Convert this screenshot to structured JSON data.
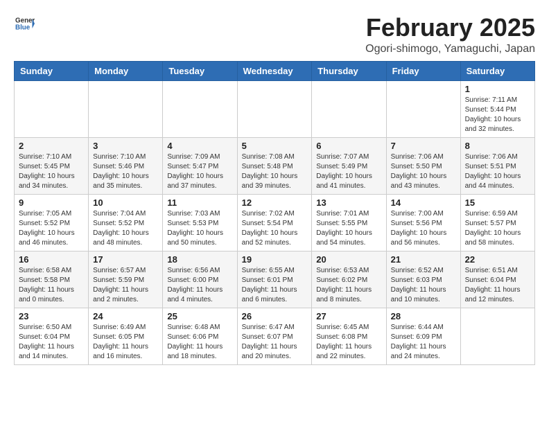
{
  "header": {
    "logo_general": "General",
    "logo_blue": "Blue",
    "month_title": "February 2025",
    "location": "Ogori-shimogo, Yamaguchi, Japan"
  },
  "weekdays": [
    "Sunday",
    "Monday",
    "Tuesday",
    "Wednesday",
    "Thursday",
    "Friday",
    "Saturday"
  ],
  "weeks": [
    [
      {
        "day": "",
        "info": ""
      },
      {
        "day": "",
        "info": ""
      },
      {
        "day": "",
        "info": ""
      },
      {
        "day": "",
        "info": ""
      },
      {
        "day": "",
        "info": ""
      },
      {
        "day": "",
        "info": ""
      },
      {
        "day": "1",
        "info": "Sunrise: 7:11 AM\nSunset: 5:44 PM\nDaylight: 10 hours and 32 minutes."
      }
    ],
    [
      {
        "day": "2",
        "info": "Sunrise: 7:10 AM\nSunset: 5:45 PM\nDaylight: 10 hours and 34 minutes."
      },
      {
        "day": "3",
        "info": "Sunrise: 7:10 AM\nSunset: 5:46 PM\nDaylight: 10 hours and 35 minutes."
      },
      {
        "day": "4",
        "info": "Sunrise: 7:09 AM\nSunset: 5:47 PM\nDaylight: 10 hours and 37 minutes."
      },
      {
        "day": "5",
        "info": "Sunrise: 7:08 AM\nSunset: 5:48 PM\nDaylight: 10 hours and 39 minutes."
      },
      {
        "day": "6",
        "info": "Sunrise: 7:07 AM\nSunset: 5:49 PM\nDaylight: 10 hours and 41 minutes."
      },
      {
        "day": "7",
        "info": "Sunrise: 7:06 AM\nSunset: 5:50 PM\nDaylight: 10 hours and 43 minutes."
      },
      {
        "day": "8",
        "info": "Sunrise: 7:06 AM\nSunset: 5:51 PM\nDaylight: 10 hours and 44 minutes."
      }
    ],
    [
      {
        "day": "9",
        "info": "Sunrise: 7:05 AM\nSunset: 5:52 PM\nDaylight: 10 hours and 46 minutes."
      },
      {
        "day": "10",
        "info": "Sunrise: 7:04 AM\nSunset: 5:52 PM\nDaylight: 10 hours and 48 minutes."
      },
      {
        "day": "11",
        "info": "Sunrise: 7:03 AM\nSunset: 5:53 PM\nDaylight: 10 hours and 50 minutes."
      },
      {
        "day": "12",
        "info": "Sunrise: 7:02 AM\nSunset: 5:54 PM\nDaylight: 10 hours and 52 minutes."
      },
      {
        "day": "13",
        "info": "Sunrise: 7:01 AM\nSunset: 5:55 PM\nDaylight: 10 hours and 54 minutes."
      },
      {
        "day": "14",
        "info": "Sunrise: 7:00 AM\nSunset: 5:56 PM\nDaylight: 10 hours and 56 minutes."
      },
      {
        "day": "15",
        "info": "Sunrise: 6:59 AM\nSunset: 5:57 PM\nDaylight: 10 hours and 58 minutes."
      }
    ],
    [
      {
        "day": "16",
        "info": "Sunrise: 6:58 AM\nSunset: 5:58 PM\nDaylight: 11 hours and 0 minutes."
      },
      {
        "day": "17",
        "info": "Sunrise: 6:57 AM\nSunset: 5:59 PM\nDaylight: 11 hours and 2 minutes."
      },
      {
        "day": "18",
        "info": "Sunrise: 6:56 AM\nSunset: 6:00 PM\nDaylight: 11 hours and 4 minutes."
      },
      {
        "day": "19",
        "info": "Sunrise: 6:55 AM\nSunset: 6:01 PM\nDaylight: 11 hours and 6 minutes."
      },
      {
        "day": "20",
        "info": "Sunrise: 6:53 AM\nSunset: 6:02 PM\nDaylight: 11 hours and 8 minutes."
      },
      {
        "day": "21",
        "info": "Sunrise: 6:52 AM\nSunset: 6:03 PM\nDaylight: 11 hours and 10 minutes."
      },
      {
        "day": "22",
        "info": "Sunrise: 6:51 AM\nSunset: 6:04 PM\nDaylight: 11 hours and 12 minutes."
      }
    ],
    [
      {
        "day": "23",
        "info": "Sunrise: 6:50 AM\nSunset: 6:04 PM\nDaylight: 11 hours and 14 minutes."
      },
      {
        "day": "24",
        "info": "Sunrise: 6:49 AM\nSunset: 6:05 PM\nDaylight: 11 hours and 16 minutes."
      },
      {
        "day": "25",
        "info": "Sunrise: 6:48 AM\nSunset: 6:06 PM\nDaylight: 11 hours and 18 minutes."
      },
      {
        "day": "26",
        "info": "Sunrise: 6:47 AM\nSunset: 6:07 PM\nDaylight: 11 hours and 20 minutes."
      },
      {
        "day": "27",
        "info": "Sunrise: 6:45 AM\nSunset: 6:08 PM\nDaylight: 11 hours and 22 minutes."
      },
      {
        "day": "28",
        "info": "Sunrise: 6:44 AM\nSunset: 6:09 PM\nDaylight: 11 hours and 24 minutes."
      },
      {
        "day": "",
        "info": ""
      }
    ]
  ]
}
